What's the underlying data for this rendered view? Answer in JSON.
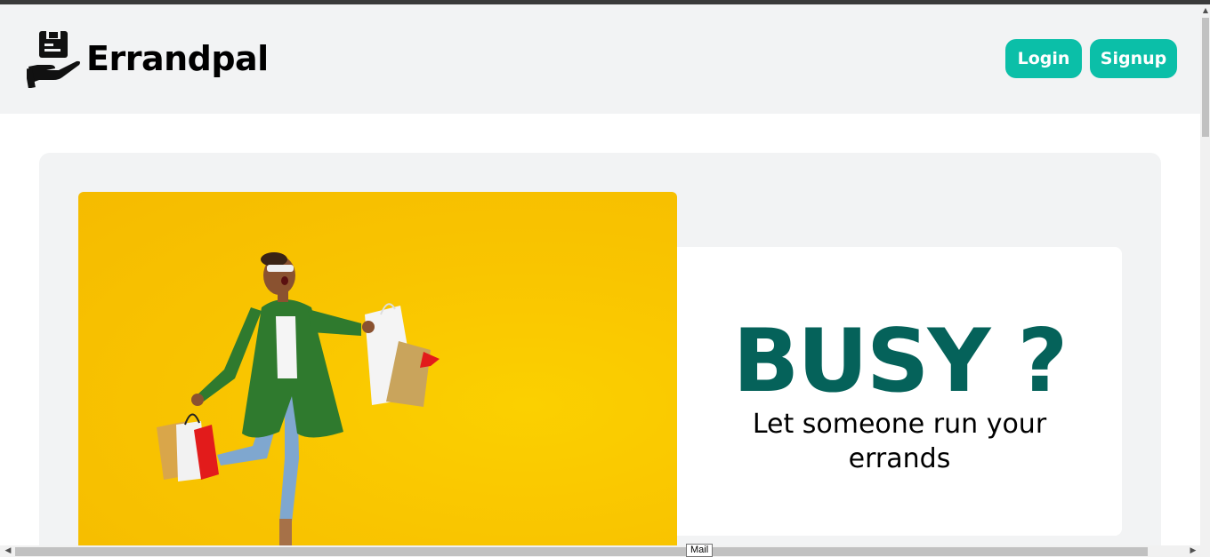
{
  "header": {
    "brand": "Errandpal",
    "login_label": "Login",
    "signup_label": "Signup"
  },
  "hero": {
    "headline": "BUSY ?",
    "subline": "Let someone run your errands"
  },
  "tooltip": "Mail",
  "colors": {
    "accent": "#0bbfa8",
    "headline": "#05625a",
    "hero_bg": "#f9c500",
    "panel_bg": "#f2f3f4"
  }
}
